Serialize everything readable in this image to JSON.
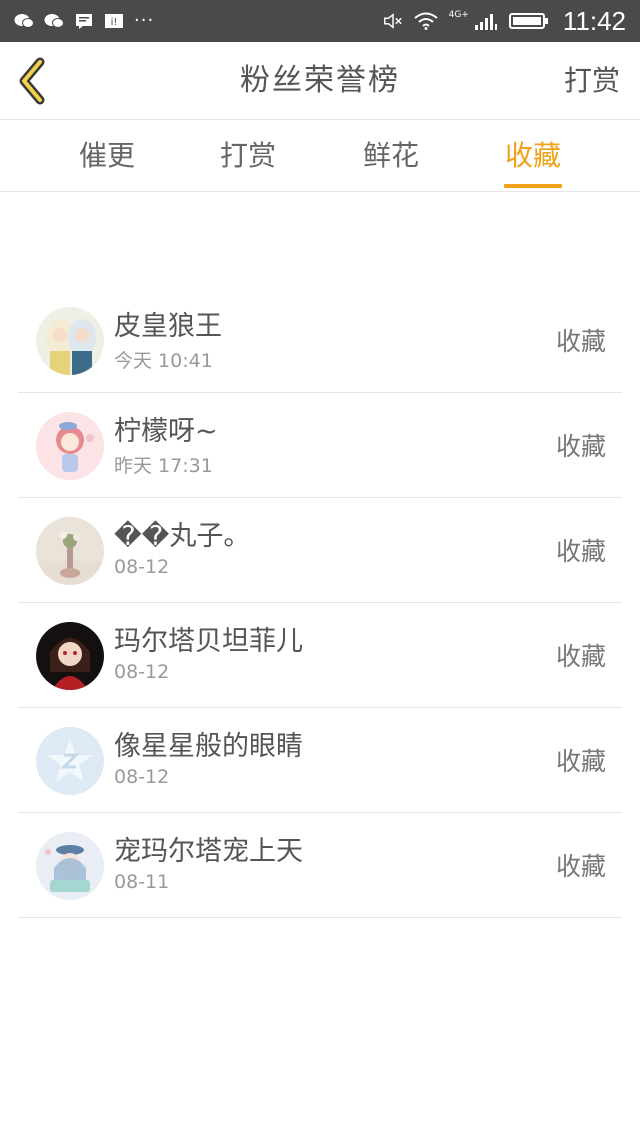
{
  "status_bar": {
    "time": "11:42",
    "network": "4G+",
    "left_icons": [
      "wechat-icon",
      "wechat-icon",
      "message-icon",
      "app-icon"
    ],
    "more": "···"
  },
  "header": {
    "title": "粉丝荣誉榜",
    "right_link": "打赏"
  },
  "tabs": [
    {
      "label": "催更",
      "active": false
    },
    {
      "label": "打赏",
      "active": false
    },
    {
      "label": "鲜花",
      "active": false
    },
    {
      "label": "收藏",
      "active": true
    }
  ],
  "accent_color": "#f0a21a",
  "fans": [
    {
      "name": "皮皇狼王",
      "time": "今天 10:41",
      "action": "收藏"
    },
    {
      "name": "柠檬呀~",
      "time": "昨天 17:31",
      "action": "收藏"
    },
    {
      "name": "��丸子。",
      "time": "08-12",
      "action": "收藏"
    },
    {
      "name": "玛尔塔贝坦菲儿",
      "time": "08-12",
      "action": "收藏"
    },
    {
      "name": "像星星般的眼睛",
      "time": "08-12",
      "action": "收藏"
    },
    {
      "name": "宠玛尔塔宠上天",
      "time": "08-11",
      "action": "收藏"
    }
  ]
}
